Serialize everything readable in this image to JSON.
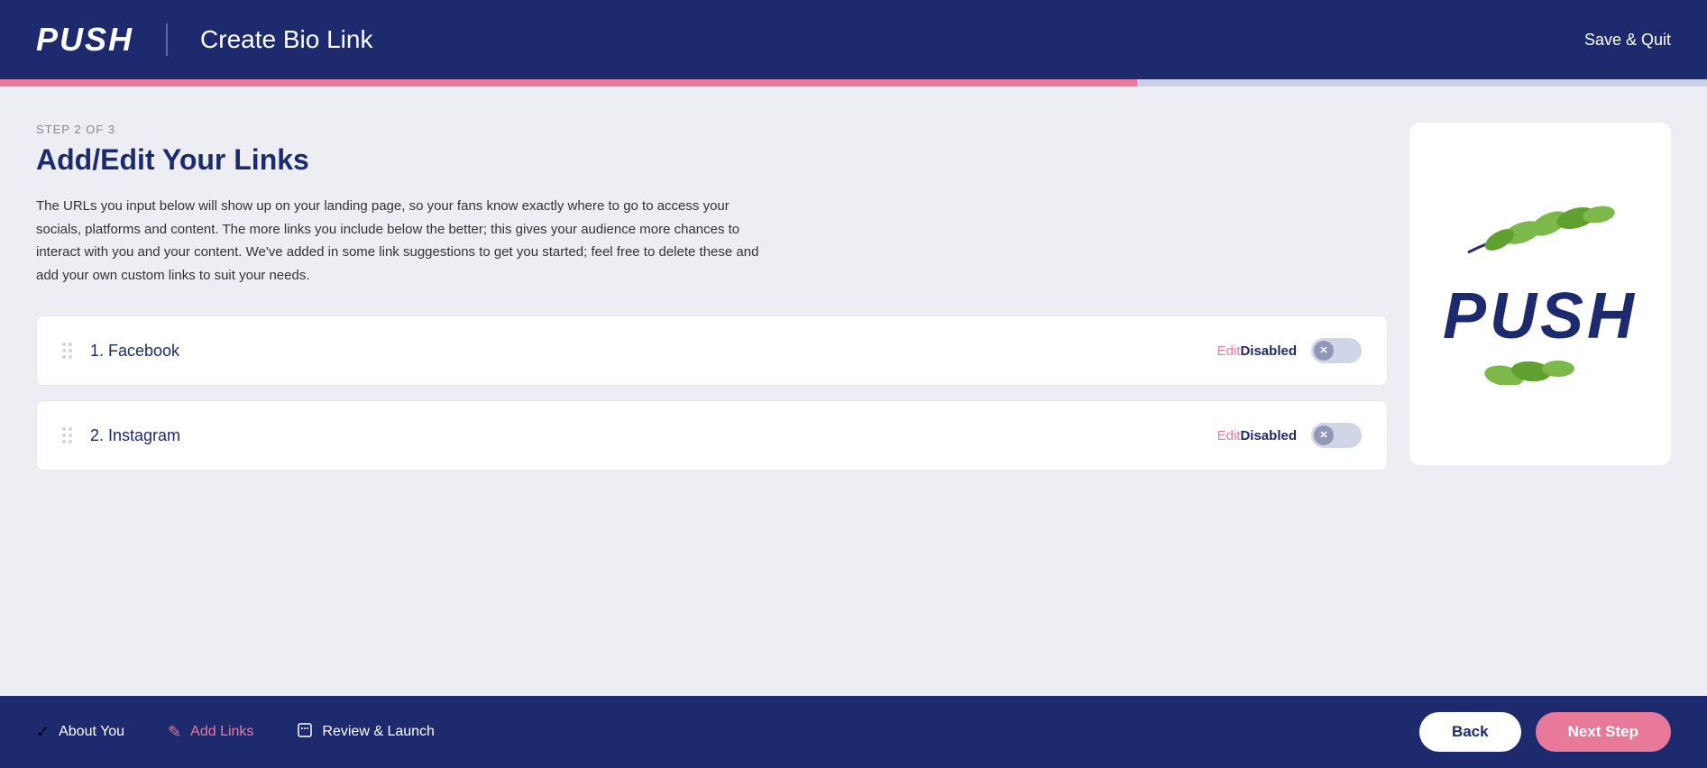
{
  "header": {
    "logo": "PUSH",
    "title": "Create Bio Link",
    "save_quit_label": "Save & Quit"
  },
  "progress": {
    "step": 2,
    "total": 3,
    "percent": 66.6
  },
  "main": {
    "step_label": "STEP 2 OF 3",
    "page_title": "Add/Edit Your Links",
    "description": "The URLs you input below will show up on your landing page, so your fans know exactly where to go to access your socials, platforms and content. The more links you include below the better; this gives your audience more chances to interact with you and your content. We've added in some link suggestions to get you started; feel free to delete these and add your own custom links to suit your needs."
  },
  "links": [
    {
      "number": "1.",
      "name": "Facebook",
      "edit_label": "Edit",
      "status": "Disabled"
    },
    {
      "number": "2.",
      "name": "Instagram",
      "edit_label": "Edit",
      "status": "Disabled"
    }
  ],
  "preview": {
    "brand_text": "PUSH"
  },
  "footer": {
    "steps": [
      {
        "label": "About You",
        "icon": "✓",
        "active": false
      },
      {
        "label": "Add Links",
        "icon": "✎",
        "active": true
      },
      {
        "label": "Review & Launch",
        "icon": "⬜",
        "active": false
      }
    ],
    "back_label": "Back",
    "next_label": "Next Step"
  }
}
